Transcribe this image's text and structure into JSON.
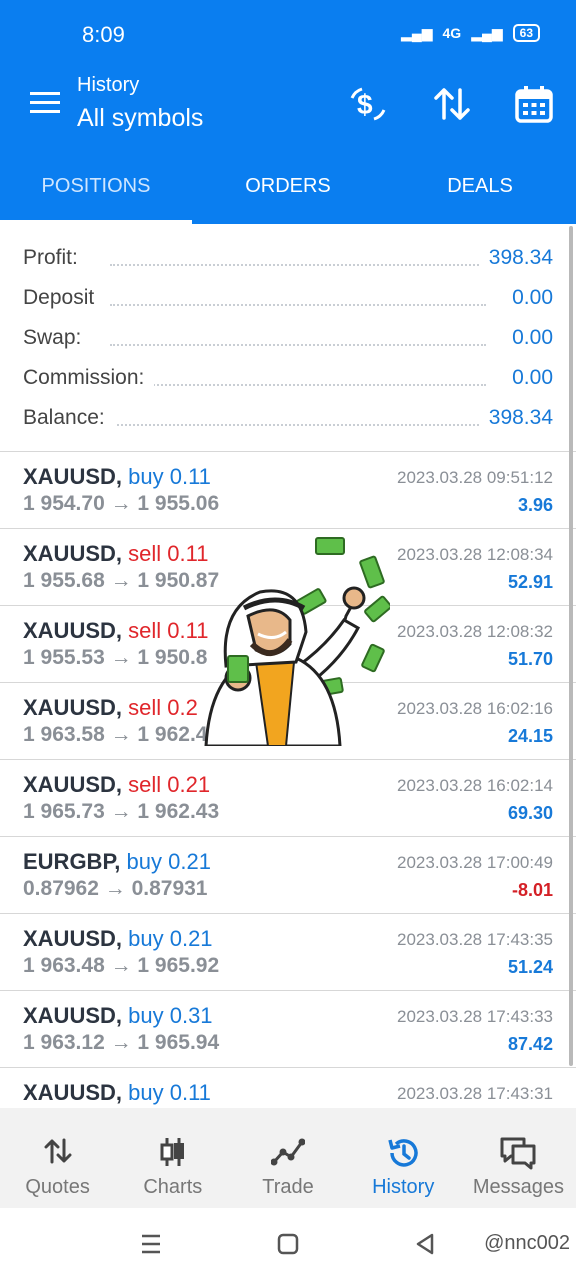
{
  "status_bar": {
    "time": "8:09",
    "network": "4G",
    "battery": "63"
  },
  "header": {
    "subtitle": "History",
    "title": "All symbols"
  },
  "tabs": [
    {
      "label": "POSITIONS",
      "active": true
    },
    {
      "label": "ORDERS",
      "active": false
    },
    {
      "label": "DEALS",
      "active": false
    }
  ],
  "summary": [
    {
      "label": "Profit:",
      "value": "398.34"
    },
    {
      "label": "Deposit",
      "value": "0.00"
    },
    {
      "label": "Swap:",
      "value": "0.00"
    },
    {
      "label": "Commission:",
      "value": "0.00"
    },
    {
      "label": "Balance:",
      "value": "398.34"
    }
  ],
  "deals": [
    {
      "symbol": "XAUUSD,",
      "side": "buy",
      "volume": "buy 0.11",
      "prices": "1 954.70 → 1 955.06",
      "time": "2023.03.28 09:51:12",
      "profit": "3.96"
    },
    {
      "symbol": "XAUUSD,",
      "side": "sell",
      "volume": "sell 0.11",
      "prices": "1 955.68 → 1 950.87",
      "time": "2023.03.28 12:08:34",
      "profit": "52.91"
    },
    {
      "symbol": "XAUUSD,",
      "side": "sell",
      "volume": "sell 0.11",
      "prices": "1 955.53 → 1 950.8",
      "time": "2023.03.28 12:08:32",
      "profit": "51.70"
    },
    {
      "symbol": "XAUUSD,",
      "side": "sell",
      "volume": "sell 0.2",
      "prices": "1 963.58 → 1 962.4",
      "time": "2023.03.28 16:02:16",
      "profit": "24.15"
    },
    {
      "symbol": "XAUUSD,",
      "side": "sell",
      "volume": "sell 0.21",
      "prices": "1 965.73 → 1 962.43",
      "time": "2023.03.28 16:02:14",
      "profit": "69.30"
    },
    {
      "symbol": "EURGBP,",
      "side": "buy",
      "volume": "buy 0.21",
      "prices": "0.87962 → 0.87931",
      "time": "2023.03.28 17:00:49",
      "profit": "-8.01"
    },
    {
      "symbol": "XAUUSD,",
      "side": "buy",
      "volume": "buy 0.21",
      "prices": "1 963.48 → 1 965.92",
      "time": "2023.03.28 17:43:35",
      "profit": "51.24"
    },
    {
      "symbol": "XAUUSD,",
      "side": "buy",
      "volume": "buy 0.31",
      "prices": "1 963.12 → 1 965.94",
      "time": "2023.03.28 17:43:33",
      "profit": "87.42"
    },
    {
      "symbol": "XAUUSD,",
      "side": "buy",
      "volume": "buy 0.11",
      "prices": "",
      "time": "2023.03.28 17:43:31",
      "profit": ""
    }
  ],
  "bottom_nav": [
    {
      "label": "Quotes",
      "icon": "quotes-icon"
    },
    {
      "label": "Charts",
      "icon": "charts-icon"
    },
    {
      "label": "Trade",
      "icon": "trade-icon"
    },
    {
      "label": "History",
      "icon": "history-icon",
      "active": true
    },
    {
      "label": "Messages",
      "icon": "messages-icon"
    }
  ],
  "watermark": "@nnc002",
  "colors": {
    "primary": "#0a7ef0",
    "buy": "#1779d8",
    "sell": "#e0262b"
  }
}
